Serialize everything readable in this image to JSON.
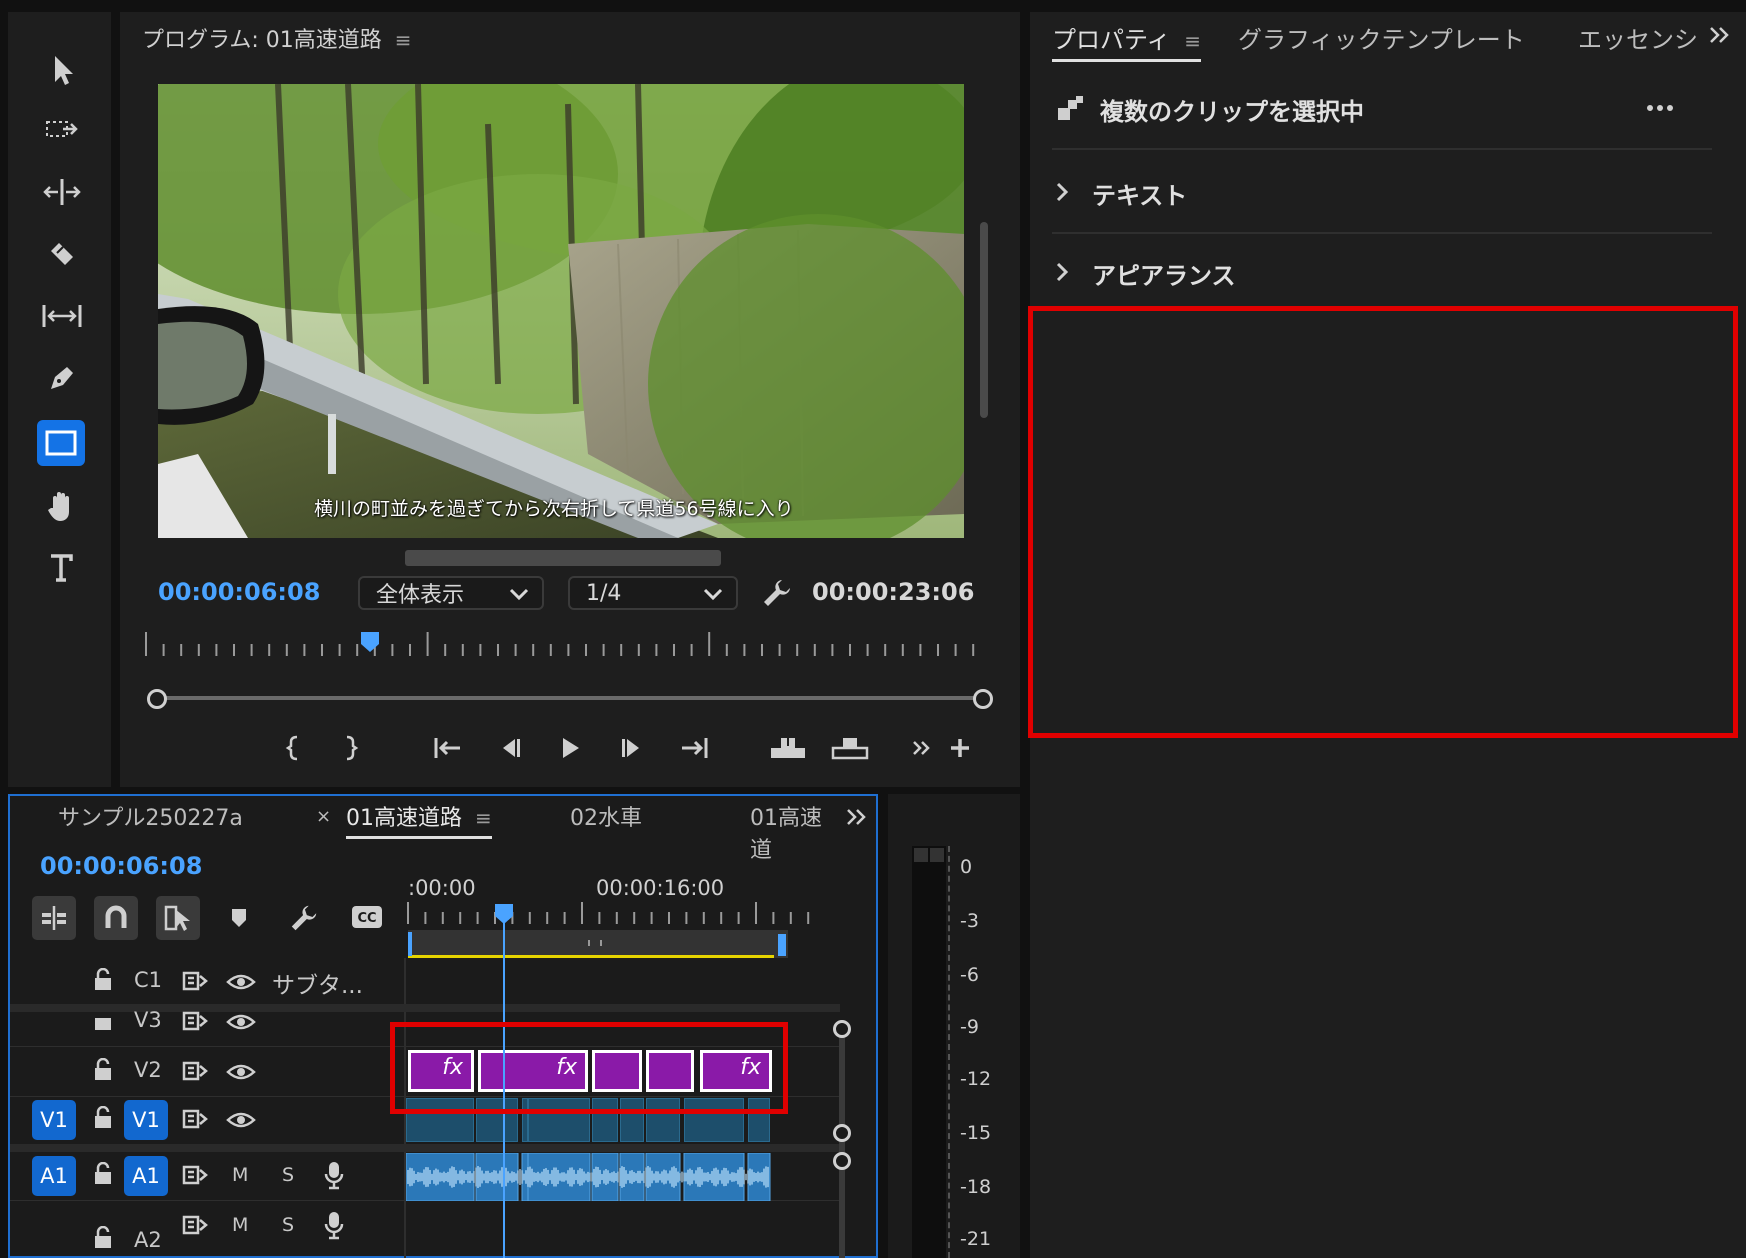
{
  "program_monitor": {
    "title": "プログラム: 01高速道路",
    "subtitle_overlay": "横川の町並みを過ぎてから次右折して県道56号線に入り",
    "current_timecode": "00:00:06:08",
    "fit_dropdown": "全体表示",
    "resolution_dropdown": "1/4",
    "duration_timecode": "00:00:23:06",
    "playhead_fraction": 0.27
  },
  "properties_panel": {
    "tabs": [
      "プロパティ",
      "グラフィックテンプレート",
      "エッセンシ"
    ],
    "selection_label": "複数のクリップを選択中",
    "sections": [
      "テキスト",
      "アピアランス"
    ]
  },
  "timeline": {
    "tabs": [
      "サンプル250227a",
      "01高速道路",
      "02水車",
      "01高速道"
    ],
    "active_tab": "01高速道路",
    "timecode": "00:00:06:08",
    "ruler_labels": [
      ":00:00",
      "00:00:16:00"
    ],
    "tracks": {
      "c1": {
        "label": "C1",
        "name": "サブタ..."
      },
      "v3": {
        "label": "V3"
      },
      "v2": {
        "label": "V2"
      },
      "v1": {
        "source": "V1",
        "label": "V1"
      },
      "a1": {
        "source": "A1",
        "label": "A1",
        "m": "M",
        "s": "S"
      },
      "a2": {
        "label": "A2",
        "m": "M",
        "s": "S"
      }
    },
    "v2_clips": [
      "fx",
      "fx",
      "",
      "",
      "fx"
    ],
    "playhead_fraction": 0.24
  },
  "audio_meter": {
    "scale": [
      "0",
      "-3",
      "-6",
      "-9",
      "-12",
      "-15",
      "-18",
      "-21"
    ]
  },
  "colors": {
    "accent_blue": "#4aa3ff",
    "highlight_red": "#e00000",
    "clip_purple": "#8a1aa8",
    "clip_blue": "#1d4e6b",
    "audio_blue": "#2b78b8"
  }
}
